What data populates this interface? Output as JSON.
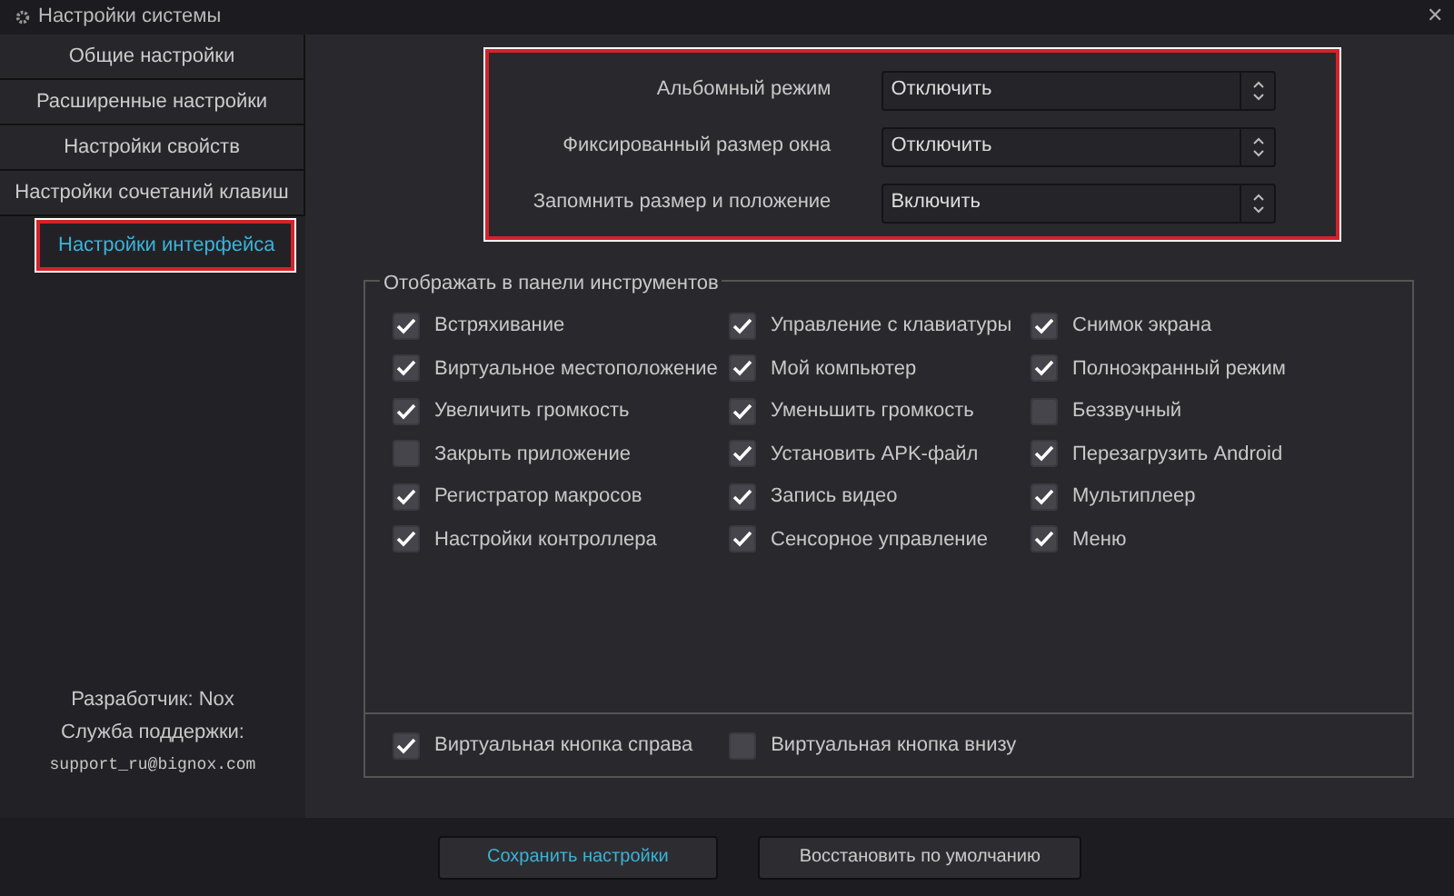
{
  "window": {
    "title": "Настройки системы",
    "close": "✕"
  },
  "sidebar": {
    "items": [
      {
        "label": "Общие настройки",
        "selected": false
      },
      {
        "label": "Расширенные настройки",
        "selected": false
      },
      {
        "label": "Настройки свойств",
        "selected": false
      },
      {
        "label": "Настройки сочетаний клавиш",
        "selected": false
      },
      {
        "label": "Настройки интерфейса",
        "selected": true
      }
    ],
    "developer": "Разработчик: Nox",
    "support_label": "Служба поддержки:",
    "support_email": "support_ru@bignox.com"
  },
  "settings": [
    {
      "label": "Альбомный режим",
      "value": "Отключить"
    },
    {
      "label": "Фиксированный размер окна",
      "value": "Отключить"
    },
    {
      "label": "Запомнить размер и положение",
      "value": "Включить"
    }
  ],
  "toolbar_group": {
    "title": "Отображать в панели инструментов",
    "items": [
      {
        "label": "Встряхивание",
        "checked": true
      },
      {
        "label": "Управление с клавиатуры",
        "checked": true
      },
      {
        "label": "Снимок экрана",
        "checked": true
      },
      {
        "label": "Виртуальное местоположение",
        "checked": true
      },
      {
        "label": "Мой компьютер",
        "checked": true
      },
      {
        "label": "Полноэкранный режим",
        "checked": true
      },
      {
        "label": "Увеличить громкость",
        "checked": true
      },
      {
        "label": "Уменьшить громкость",
        "checked": true
      },
      {
        "label": "Беззвучный",
        "checked": false
      },
      {
        "label": "Закрыть приложение",
        "checked": false
      },
      {
        "label": "Установить APK-файл",
        "checked": true
      },
      {
        "label": "Перезагрузить Android",
        "checked": true
      },
      {
        "label": "Регистратор макросов",
        "checked": true
      },
      {
        "label": "Запись видео",
        "checked": true
      },
      {
        "label": "Мультиплеер",
        "checked": true
      },
      {
        "label": "Настройки контроллера",
        "checked": true
      },
      {
        "label": "Сенсорное управление",
        "checked": true
      },
      {
        "label": "Меню",
        "checked": true
      }
    ],
    "bottom_items": [
      {
        "label": "Виртуальная кнопка справа",
        "checked": true
      },
      {
        "label": "Виртуальная кнопка внизу",
        "checked": false
      }
    ]
  },
  "buttons": [
    {
      "label": "Сохранить настройки",
      "primary": true
    },
    {
      "label": "Восстановить по умолчанию",
      "primary": false
    }
  ]
}
